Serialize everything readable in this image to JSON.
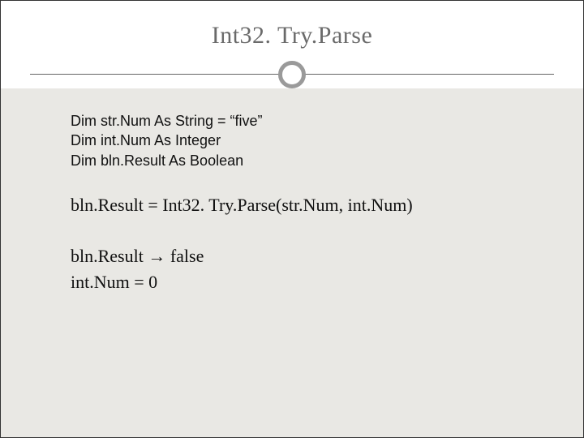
{
  "slide": {
    "title": "Int32. Try.Parse",
    "declarations": {
      "line1": "Dim str.Num As String = “five”",
      "line2": "Dim int.Num As Integer",
      "line3": "Dim bln.Result As Boolean"
    },
    "main_statement": "bln.Result = Int32. Try.Parse(str.Num, int.Num)",
    "results": {
      "line1": "bln.Result → false",
      "line2": "int.Num = 0"
    }
  }
}
